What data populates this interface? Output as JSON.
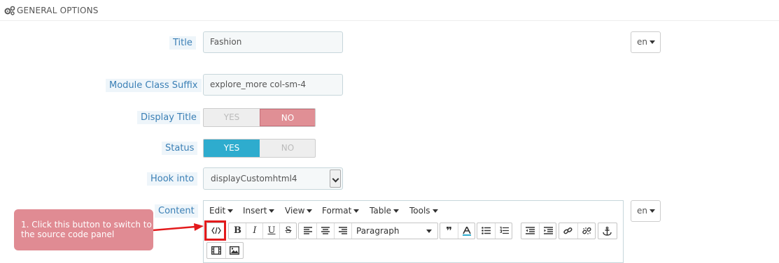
{
  "header": {
    "title": "GENERAL OPTIONS",
    "icon": "gears-icon"
  },
  "fields": {
    "title": {
      "label": "Title",
      "value": "Fashion",
      "lang": "en"
    },
    "suffix": {
      "label": "Module Class Suffix",
      "value": "explore_more col-sm-4"
    },
    "display_title": {
      "label": "Display Title",
      "yes": "YES",
      "no": "NO",
      "selected": "NO"
    },
    "status": {
      "label": "Status",
      "yes": "YES",
      "no": "NO",
      "selected": "YES"
    },
    "hook": {
      "label": "Hook into",
      "value": "displayCustomhtml4"
    },
    "content": {
      "label": "Content",
      "lang": "en"
    }
  },
  "editor": {
    "menus": [
      "Edit",
      "Insert",
      "View",
      "Format",
      "Table",
      "Tools"
    ],
    "format_select": "Paragraph",
    "buttons": [
      "source-code",
      "bold",
      "italic",
      "underline",
      "strikethrough",
      "align-left",
      "align-center",
      "align-right",
      "blockquote",
      "text-color",
      "bullet-list",
      "numbered-list",
      "outdent",
      "indent",
      "link",
      "unlink",
      "anchor",
      "media",
      "image"
    ]
  },
  "annotation": {
    "text": "1. Click this button to switch to the source code panel"
  },
  "colors": {
    "accent_blue": "#2eacce",
    "accent_red": "#e08f95",
    "label_blue": "#3a7fb5",
    "callout": "#e08b93",
    "highlight": "#e31a1c"
  }
}
